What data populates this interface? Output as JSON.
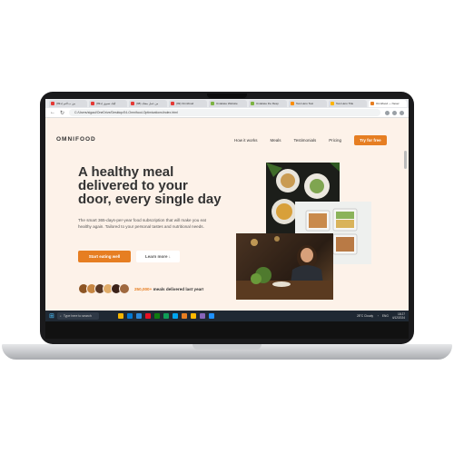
{
  "browser": {
    "tabs": [
      {
        "label": "(99+) بين ب التم",
        "color": "#e53935"
      },
      {
        "label": "(99+) إليك نسوي",
        "color": "#e53935"
      },
      {
        "label": "(98) من عمل مشك",
        "color": "#e53935"
      },
      {
        "label": "(99) Omnifood",
        "color": "#e53935"
      },
      {
        "label": "Undelete Website",
        "color": "#7cb342"
      },
      {
        "label": "Undelete the Resp",
        "color": "#7cb342"
      },
      {
        "label": "Test Hero Test",
        "color": "#fb8c00"
      },
      {
        "label": "Test Hero Title",
        "color": "#ffb300"
      },
      {
        "label": "Omnifood — Never",
        "color": "#e67e22"
      }
    ],
    "url": "C:/Users/sigaul/OneDrive/Desktop/04-Omnifood-Optimizations/index.html",
    "window_controls": [
      "—",
      "□",
      "✕"
    ]
  },
  "nav": {
    "logo": "OMNIFOOD",
    "links": [
      "How it works",
      "Meals",
      "Testimonials",
      "Pricing"
    ],
    "cta": "Try for free"
  },
  "hero": {
    "title": "A healthy meal delivered to your door, every single day",
    "description": "The smart 365-days-per-year food subscription that will make you eat healthy again. Tailored to your personal tastes and nutritional needs.",
    "primary_button": "Start eating well",
    "secondary_button": "Learn more ↓",
    "delivered_count": "250,000+",
    "delivered_text": "meals delivered last year!",
    "avatar_colors": [
      "#8d5524",
      "#c68642",
      "#5a3825",
      "#e0ac69",
      "#3b2219",
      "#a0693f"
    ]
  },
  "taskbar": {
    "search_placeholder": "Type here to search",
    "weather": "28°C Cloudy",
    "language": "ENG",
    "time": "18:27",
    "date": "4/12/2024",
    "app_colors": [
      "#f4b400",
      "#0078d4",
      "#2b88d8",
      "#e81123",
      "#107c10",
      "#0f9d58",
      "#00a4ef",
      "#e67e22",
      "#ffb900",
      "#8764b8",
      "#1e90ff"
    ]
  },
  "colors": {
    "brand": "#e67e22",
    "page_bg": "#fdf2e9",
    "dark_text": "#333333"
  }
}
